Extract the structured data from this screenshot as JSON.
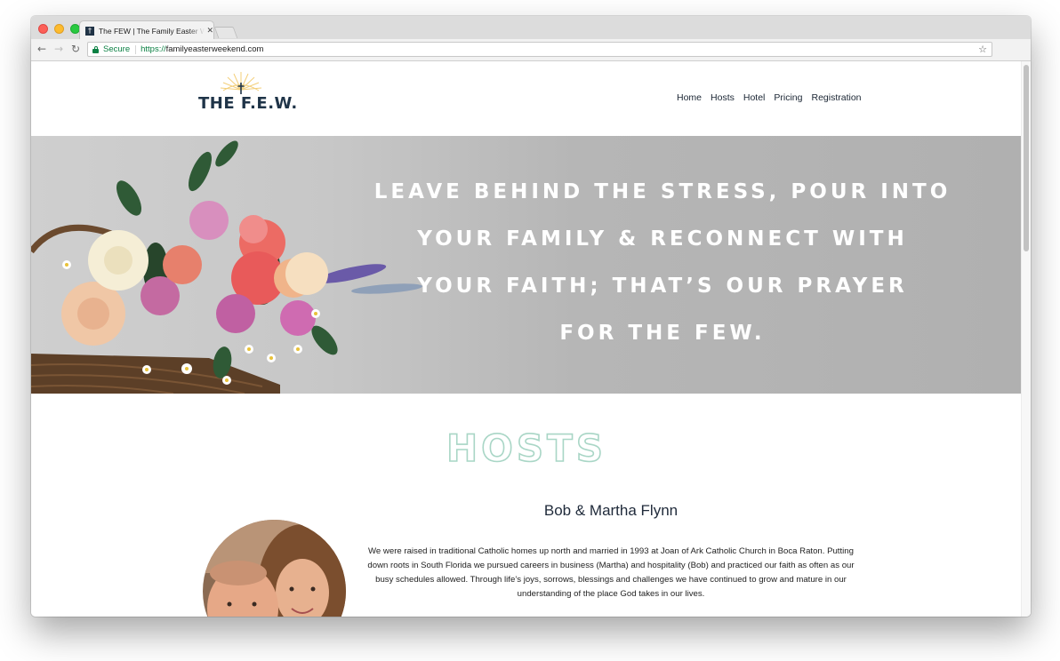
{
  "browser": {
    "tab_title": "The FEW | The Family Easter W",
    "security_label": "Secure",
    "url_scheme": "https://",
    "url_host": "familyeasterweekend.com"
  },
  "site": {
    "logo_text": "THE F.E.W.",
    "nav": [
      "Home",
      "Hosts",
      "Hotel",
      "Pricing",
      "Registration"
    ]
  },
  "hero": {
    "lines": [
      "LEAVE BEHIND THE STRESS, POUR INTO",
      "YOUR FAMILY & RECONNECT WITH",
      "YOUR FAITH; THAT’S OUR PRAYER",
      "FOR THE FEW."
    ]
  },
  "hosts": {
    "title": "HOSTS",
    "names": "Bob & Martha Flynn",
    "bio": "We were raised in traditional Catholic homes up north and married in 1993 at Joan of Ark Catholic Church in Boca Raton. Putting down roots in South Florida we pursued careers in business (Martha) and hospitality (Bob) and practiced our faith as often as our busy schedules allowed. Through life’s joys, sorrows, blessings and challenges we have continued to grow and mature in our understanding of the place God takes in our lives."
  },
  "colors": {
    "navy": "#1f3448",
    "mint": "#a9d6c6",
    "hero_gray": "#b6b6b6"
  }
}
